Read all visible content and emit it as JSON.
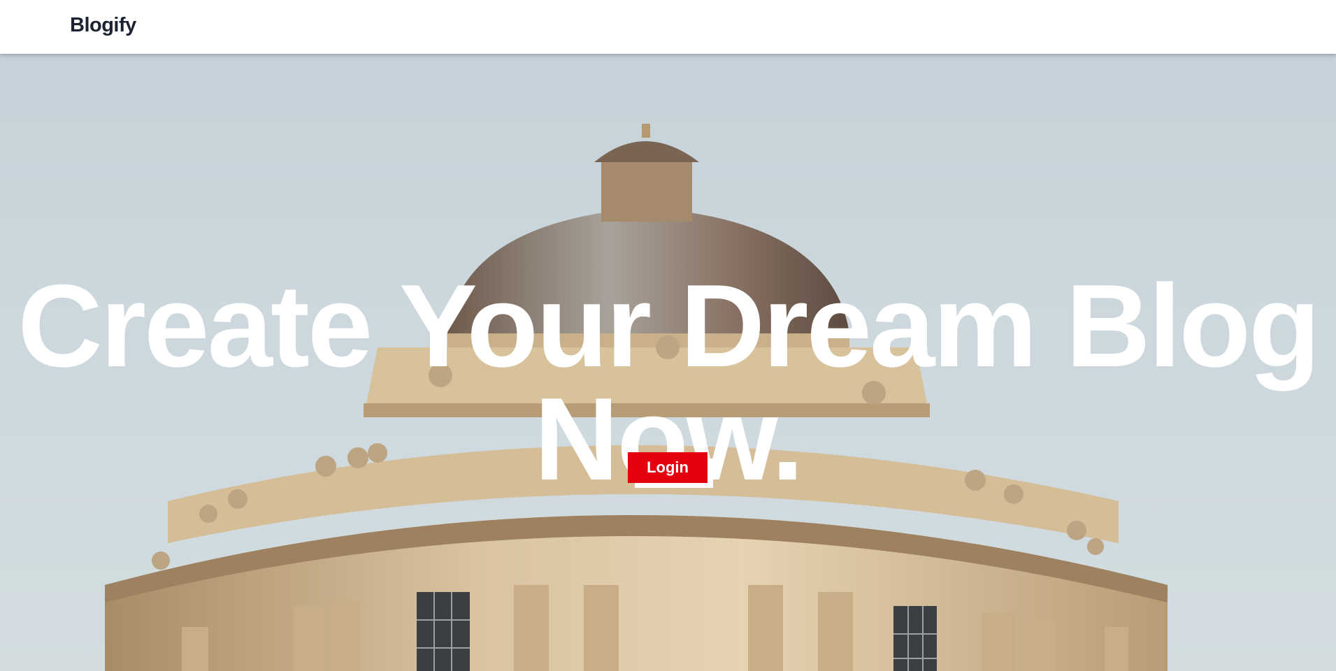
{
  "navbar": {
    "brand": "Blogify"
  },
  "hero": {
    "headline": "Create Your Dream Blog Now.",
    "login_label": "Login"
  },
  "colors": {
    "brand_text": "#1b2333",
    "accent": "#e3000f",
    "sky": "#c5d2d9"
  }
}
